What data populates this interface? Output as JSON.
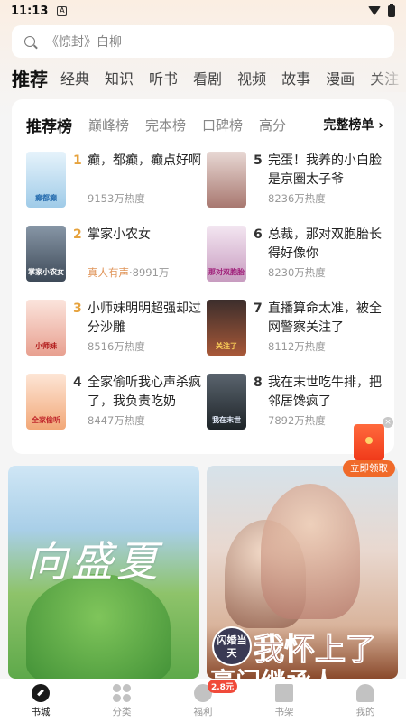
{
  "status_bar": {
    "time": "11:13"
  },
  "search": {
    "placeholder": "《惊封》白柳"
  },
  "categories": [
    "推荐",
    "经典",
    "知识",
    "听书",
    "看剧",
    "视频",
    "故事",
    "漫画",
    "关注"
  ],
  "ranking": {
    "tabs": [
      "推荐榜",
      "巅峰榜",
      "完本榜",
      "口碑榜",
      "高分"
    ],
    "more_label": "完整榜单 ›",
    "items": [
      {
        "rank": "1",
        "title": "癫，都癫，癫点好啊",
        "heat": "9153万热度",
        "cover_color": "#bfe0f2",
        "cover_text": "癫都癫"
      },
      {
        "rank": "2",
        "title": "掌家小农女",
        "tag": "真人有声",
        "heat": "·8991万",
        "cover_color": "#6a7a8c",
        "cover_text": "掌家小农女"
      },
      {
        "rank": "3",
        "title": "小师妹明明超强却过分沙雕",
        "heat": "8516万热度",
        "cover_color": "#f5d2c8",
        "cover_text": "小师妹"
      },
      {
        "rank": "4",
        "title": "全家偷听我心声杀疯了，我负责吃奶",
        "heat": "8447万热度",
        "cover_color": "#f3c9b0",
        "cover_text": "全家偷听"
      },
      {
        "rank": "5",
        "title": "完蛋！我养的小白脸是京圈太子爷",
        "heat": "8236万热度",
        "cover_color": "#d9c2bc",
        "cover_text": ""
      },
      {
        "rank": "6",
        "title": "总裁，那对双胞胎长得好像你",
        "heat": "8230万热度",
        "cover_color": "#e6d2e6",
        "cover_text": "那对双胞胎"
      },
      {
        "rank": "7",
        "title": "直播算命太准，被全网警察关注了",
        "heat": "8112万热度",
        "cover_color": "#8c4a38",
        "cover_text": "关注了"
      },
      {
        "rank": "8",
        "title": "我在末世吃牛排，把邻居馋疯了",
        "heat": "7892万热度",
        "cover_color": "#4a5560",
        "cover_text": "我在末世"
      }
    ]
  },
  "banners": {
    "left_title": "向盛夏",
    "right_seal": "闪婚当天",
    "right_title": "我怀上了",
    "right_sub": "豪门继承人"
  },
  "red_packet": {
    "label": "立即领取",
    "close": "×"
  },
  "bottom_nav": {
    "items": [
      "书城",
      "分类",
      "福利",
      "书架",
      "我的"
    ],
    "badge": "2.8元"
  }
}
